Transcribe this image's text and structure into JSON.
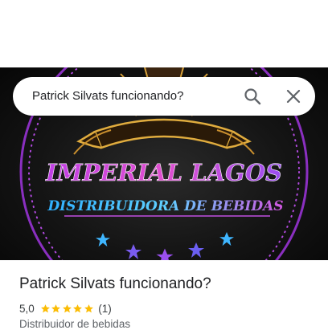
{
  "search": {
    "value": "Patrick Silvats funcionando?",
    "search_icon": "search-icon",
    "close_icon": "close-icon"
  },
  "banner": {
    "logo_title": "IMPERIAL LAGOS",
    "logo_subtitle": "DISTRIBUIDORA DE BEBIDAS"
  },
  "place": {
    "name": "Patrick Silvats funcionando?",
    "rating": "5,0",
    "stars": 5,
    "review_count": "(1)",
    "category": "Distribuidor de bebidas"
  },
  "colors": {
    "star": "#fbbc04",
    "logo_purple": "#b545e8",
    "logo_blue": "#3fb6ff",
    "banner_bg": "#111111",
    "crown_gold": "#d9a23a"
  }
}
